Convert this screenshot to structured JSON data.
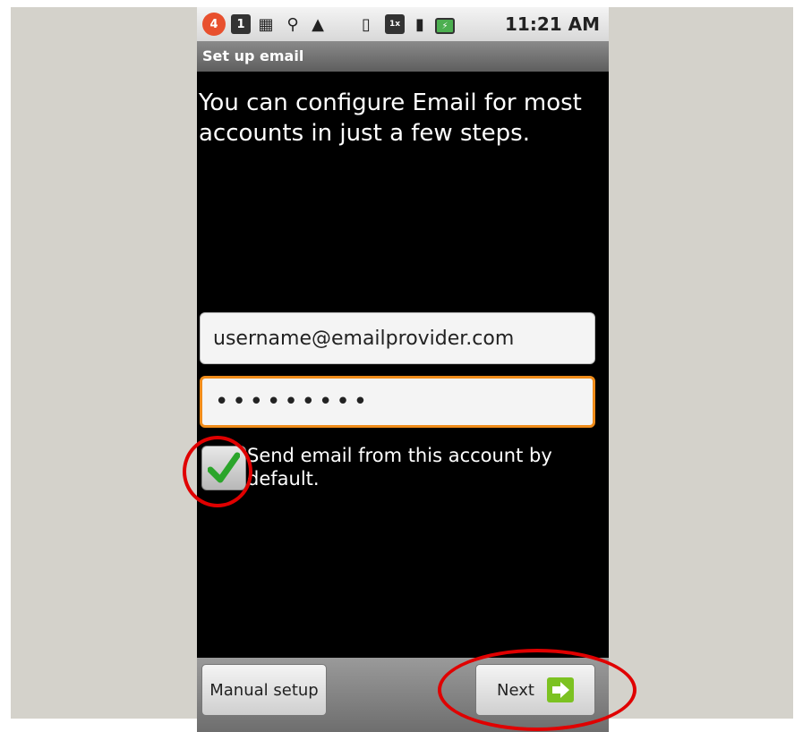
{
  "status_bar": {
    "notification_count": "4",
    "time": "11:21 AM",
    "icons": [
      "notification-badge-icon",
      "sim-icon",
      "calendar-icon",
      "usb-icon",
      "warning-icon",
      "vibrate-icon",
      "data-1x-icon",
      "signal-icon",
      "battery-charging-icon"
    ]
  },
  "title_bar": {
    "title": "Set up email"
  },
  "intro_text": "You can configure Email for most accounts in just a few steps.",
  "form": {
    "email_value": "username@emailprovider.com",
    "password_value": "•••••••••",
    "default_checkbox": {
      "checked": true,
      "label": "Send email from this account by default."
    }
  },
  "buttons": {
    "manual_setup": "Manual setup",
    "next": "Next"
  },
  "colors": {
    "focus_border": "#f08c1a",
    "annotation": "#e00000",
    "next_arrow": "#7cc221"
  }
}
